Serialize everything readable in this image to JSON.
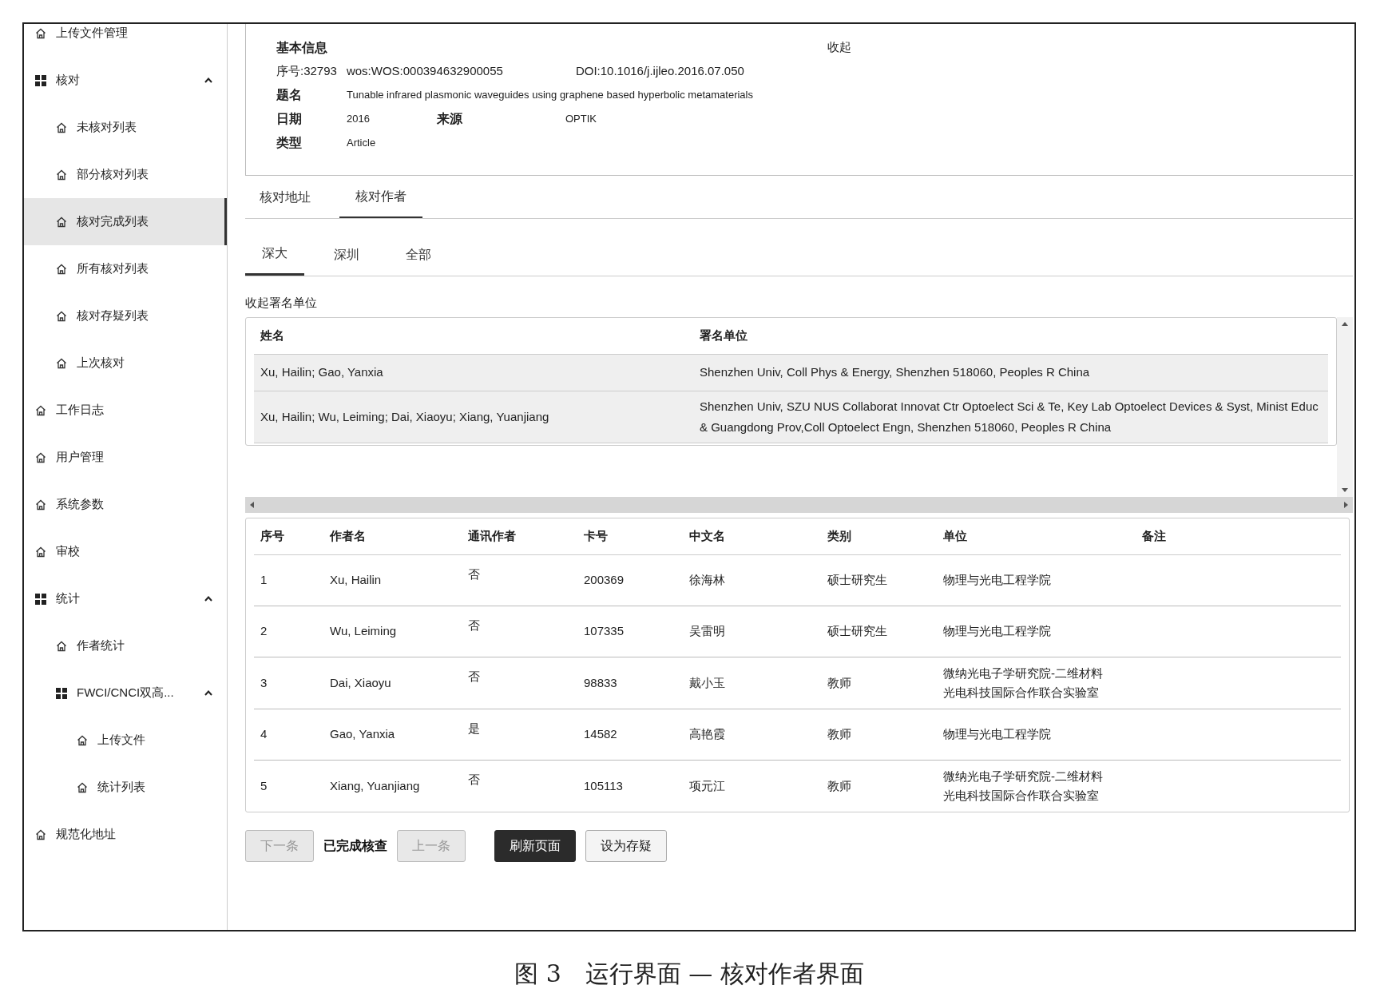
{
  "sidebar": {
    "items": [
      {
        "kind": "link",
        "label": "上传文件管理",
        "selected": false
      },
      {
        "kind": "group",
        "label": "核对",
        "expanded": true,
        "selected": false,
        "children": [
          {
            "kind": "link",
            "label": "未核对列表",
            "selected": false
          },
          {
            "kind": "link",
            "label": "部分核对列表",
            "selected": false
          },
          {
            "kind": "link",
            "label": "核对完成列表",
            "selected": true
          },
          {
            "kind": "link",
            "label": "所有核对列表",
            "selected": false
          },
          {
            "kind": "link",
            "label": "核对存疑列表",
            "selected": false
          },
          {
            "kind": "link",
            "label": "上次核对",
            "selected": false
          }
        ]
      },
      {
        "kind": "link",
        "label": "工作日志",
        "selected": false
      },
      {
        "kind": "link",
        "label": "用户管理",
        "selected": false
      },
      {
        "kind": "link",
        "label": "系统参数",
        "selected": false
      },
      {
        "kind": "link",
        "label": "审校",
        "selected": false
      },
      {
        "kind": "group",
        "label": "统计",
        "expanded": true,
        "selected": false,
        "children": [
          {
            "kind": "link",
            "label": "作者统计",
            "selected": false
          },
          {
            "kind": "group",
            "label": "FWCI/CNCI双高...",
            "expanded": true,
            "selected": false,
            "children": [
              {
                "kind": "link",
                "label": "上传文件",
                "selected": false
              },
              {
                "kind": "link",
                "label": "统计列表",
                "selected": false
              }
            ]
          }
        ]
      },
      {
        "kind": "link",
        "label": "规范化地址",
        "selected": false
      }
    ]
  },
  "info": {
    "title": "基本信息",
    "collapse": "收起",
    "serial": "序号:32793",
    "wos": "wos:WOS:000394632900055",
    "doi": "DOI:10.1016/j.ijleo.2016.07.050",
    "title_label": "题名",
    "title_value": "Tunable infrared plasmonic waveguides using graphene based hyperbolic metamaterials",
    "date_label": "日期",
    "date_value": "2016",
    "source_label": "来源",
    "source_value": "OPTIK",
    "type_label": "类型",
    "type_value": "Article"
  },
  "tabs": [
    {
      "label": "核对地址",
      "selected": false
    },
    {
      "label": "核对作者",
      "selected": true
    }
  ],
  "subtabs": [
    {
      "label": "深大",
      "selected": true
    },
    {
      "label": "深圳",
      "selected": false
    },
    {
      "label": "全部",
      "selected": false
    }
  ],
  "affiliations": {
    "toggle": "收起署名单位",
    "columns": [
      "姓名",
      "署名单位"
    ],
    "rows": [
      [
        "Xu, Hailin; Gao, Yanxia",
        "Shenzhen Univ, Coll Phys & Energy, Shenzhen 518060, Peoples R China"
      ],
      [
        "Xu, Hailin; Wu, Leiming; Dai, Xiaoyu; Xiang, Yuanjiang",
        "Shenzhen Univ, SZU NUS Collaborat Innovat Ctr Optoelect Sci & Te, Key Lab Optoelect Devices & Syst, Minist Educ & Guangdong Prov,Coll Optoelect Engn, Shenzhen 518060, Peoples R China"
      ]
    ]
  },
  "authors": {
    "columns": [
      "序号",
      "作者名",
      "通讯作者",
      "卡号",
      "中文名",
      "类别",
      "单位",
      "备注"
    ],
    "rows": [
      [
        "1",
        "Xu, Hailin",
        "否",
        "200369",
        "徐海林",
        "硕士研究生",
        "物理与光电工程学院"
      ],
      [
        "2",
        "Wu, Leiming",
        "否",
        "107335",
        "吴雷明",
        "硕士研究生",
        "物理与光电工程学院"
      ],
      [
        "3",
        "Dai, Xiaoyu",
        "否",
        "98833",
        "戴小玉",
        "教师",
        "微纳光电子学研究院-二维材料光电科技国际合作联合实验室"
      ],
      [
        "4",
        "Gao, Yanxia",
        "是",
        "14582",
        "高艳霞",
        "教师",
        "物理与光电工程学院"
      ],
      [
        "5",
        "Xiang, Yuanjiang",
        "否",
        "105113",
        "项元江",
        "教师",
        "微纳光电子学研究院-二维材料光电科技国际合作联合实验室"
      ]
    ]
  },
  "actions": [
    {
      "kind": "button",
      "label": "下一条",
      "disabled": true
    },
    {
      "kind": "status",
      "label": "已完成核查"
    },
    {
      "kind": "button",
      "label": "上一条",
      "disabled": true
    },
    {
      "kind": "primary",
      "label": "刷新页面",
      "disabled": false
    },
    {
      "kind": "button",
      "label": "设为存疑",
      "disabled": false
    }
  ],
  "caption": "图 3　运行界面 — 核对作者界面"
}
